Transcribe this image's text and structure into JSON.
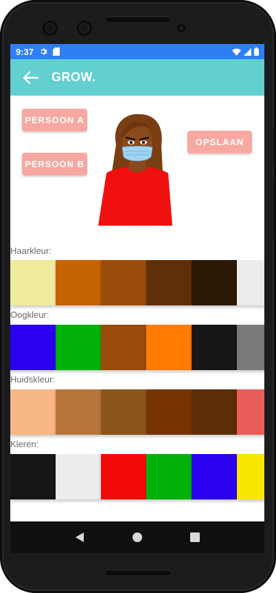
{
  "status_bar": {
    "time": "9:37",
    "icons": [
      "gear-icon",
      "sd-card-icon",
      "wifi-icon",
      "signal-icon",
      "battery-icon"
    ]
  },
  "app_bar": {
    "title": "GROW.",
    "back_icon": "arrow-back-icon",
    "background": "#62cfd0"
  },
  "buttons": {
    "person_a": "PERSOON A",
    "person_b": "PERSOON B",
    "save": "OPSLAAN",
    "color": "#f7a8a0"
  },
  "avatar": {
    "hair_color": "#7a3e12",
    "skin_color": "#8a4a1c",
    "eye_color": "#3a2412",
    "shirt_color": "#f01010",
    "mask_color": "#9fd3f2"
  },
  "sections": [
    {
      "label": "Haarkleur:",
      "colors": [
        "#efeb9c",
        "#c66304",
        "#9b4c0a",
        "#5e2f08",
        "#2d1705",
        "#ececec"
      ]
    },
    {
      "label": "Oogkleur:",
      "colors": [
        "#2c00f0",
        "#00b10a",
        "#984b0b",
        "#ff7c00",
        "#161616",
        "#7a7a7a"
      ]
    },
    {
      "label": "Huidskleur:",
      "colors": [
        "#f8b785",
        "#b8763d",
        "#8b561b",
        "#783302",
        "#5d2d06",
        "#e95d5b"
      ]
    },
    {
      "label": "Kleren:",
      "colors": [
        "#151515",
        "#ececec",
        "#f50a0a",
        "#00b10a",
        "#2a00ee",
        "#f6e600"
      ]
    }
  ],
  "nav_bar": {
    "icons": [
      "back-triangle-icon",
      "home-circle-icon",
      "recents-square-icon"
    ]
  }
}
